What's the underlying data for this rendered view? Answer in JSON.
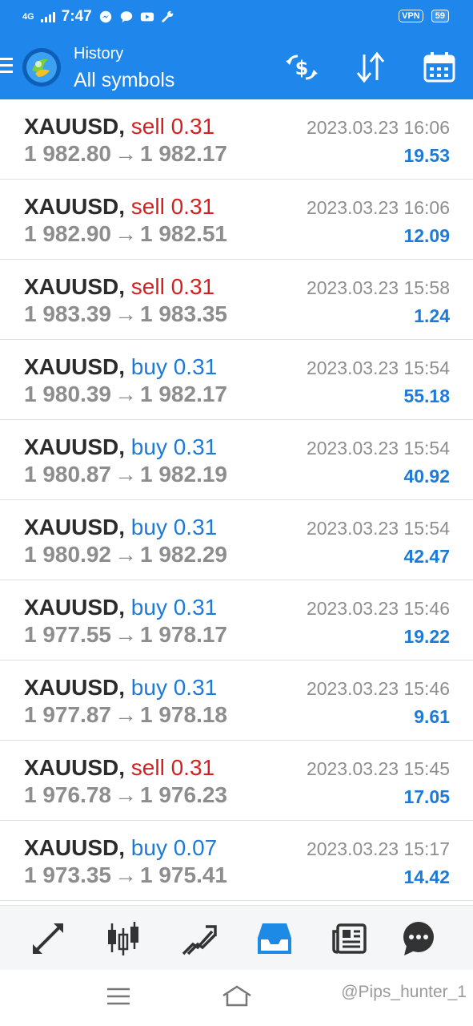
{
  "status_bar": {
    "network": "4G",
    "time": "7:47",
    "vpn_label": "VPN",
    "battery": "59"
  },
  "header": {
    "title": "History",
    "subtitle": "All symbols",
    "icons": [
      "menu-icon",
      "metatrader-logo",
      "currency-exchange-icon",
      "sort-icon",
      "calendar-icon"
    ]
  },
  "trades": [
    {
      "symbol": "XAUUSD,",
      "type": "sell",
      "volume": "sell 0.31",
      "open": "1 982.80",
      "close": "1 982.17",
      "time": "2023.03.23 16:06",
      "profit": "19.53"
    },
    {
      "symbol": "XAUUSD,",
      "type": "sell",
      "volume": "sell 0.31",
      "open": "1 982.90",
      "close": "1 982.51",
      "time": "2023.03.23 16:06",
      "profit": "12.09"
    },
    {
      "symbol": "XAUUSD,",
      "type": "sell",
      "volume": "sell 0.31",
      "open": "1 983.39",
      "close": "1 983.35",
      "time": "2023.03.23 15:58",
      "profit": "1.24"
    },
    {
      "symbol": "XAUUSD,",
      "type": "buy",
      "volume": "buy 0.31",
      "open": "1 980.39",
      "close": "1 982.17",
      "time": "2023.03.23 15:54",
      "profit": "55.18"
    },
    {
      "symbol": "XAUUSD,",
      "type": "buy",
      "volume": "buy 0.31",
      "open": "1 980.87",
      "close": "1 982.19",
      "time": "2023.03.23 15:54",
      "profit": "40.92"
    },
    {
      "symbol": "XAUUSD,",
      "type": "buy",
      "volume": "buy 0.31",
      "open": "1 980.92",
      "close": "1 982.29",
      "time": "2023.03.23 15:54",
      "profit": "42.47"
    },
    {
      "symbol": "XAUUSD,",
      "type": "buy",
      "volume": "buy 0.31",
      "open": "1 977.55",
      "close": "1 978.17",
      "time": "2023.03.23 15:46",
      "profit": "19.22"
    },
    {
      "symbol": "XAUUSD,",
      "type": "buy",
      "volume": "buy 0.31",
      "open": "1 977.87",
      "close": "1 978.18",
      "time": "2023.03.23 15:46",
      "profit": "9.61"
    },
    {
      "symbol": "XAUUSD,",
      "type": "sell",
      "volume": "sell 0.31",
      "open": "1 976.78",
      "close": "1 976.23",
      "time": "2023.03.23 15:45",
      "profit": "17.05"
    },
    {
      "symbol": "XAUUSD,",
      "type": "buy",
      "volume": "buy 0.07",
      "open": "1 973.35",
      "close": "1 975.41",
      "time": "2023.03.23 15:17",
      "profit": "14.42"
    }
  ],
  "arrow": "→",
  "bottom_nav": {
    "items": [
      "quotes-icon",
      "chart-icon",
      "trade-icon",
      "history-icon",
      "news-icon",
      "chat-icon"
    ],
    "active": "history-icon",
    "active_color": "#1d8ae6",
    "inactive_color": "#333333"
  },
  "system_nav": {
    "watermark": "@Pips_hunter_1"
  },
  "colors": {
    "header": "#1f86ec",
    "sell": "#d71f1f",
    "buy": "#1d7ad8",
    "profit": "#1d7ad8"
  }
}
